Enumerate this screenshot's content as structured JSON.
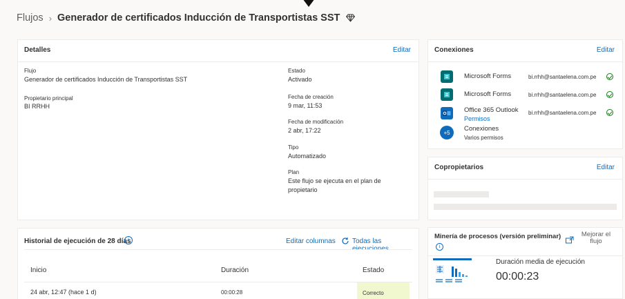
{
  "breadcrumb": {
    "root": "Flujos",
    "separator": "›",
    "title": "Generador de certificados Inducción de Transportistas SST",
    "premium_icon": "diamond-icon"
  },
  "details": {
    "title": "Detalles",
    "edit": "Editar",
    "flow_label": "Flujo",
    "flow_value": "Generador de certificados Inducción de Transportistas SST",
    "owner_label": "Propietario principal",
    "owner_value": "BI RRHH",
    "status_label": "Estado",
    "status_value": "Activado",
    "created_label": "Fecha de creación",
    "created_value": "9 mar, 11:53",
    "modified_label": "Fecha de modificación",
    "modified_value": "2 abr, 17:22",
    "type_label": "Tipo",
    "type_value": "Automatizado",
    "plan_label": "Plan",
    "plan_line1": "Este flujo se ejecuta en el plan de",
    "plan_line2": "propietario"
  },
  "connections": {
    "title": "Conexiones",
    "edit": "Editar",
    "items": [
      {
        "name": "Microsoft Forms",
        "email": "bi.rrhh@santaelena.com.pe",
        "icon": "forms-icon",
        "color": "#036c70"
      },
      {
        "name": "Microsoft Forms",
        "email": "bi.rrhh@santaelena.com.pe",
        "icon": "forms-icon",
        "color": "#036c70"
      },
      {
        "name": "Office 365 Outlook",
        "sub": "Permisos",
        "email": "bi.rrhh@santaelena.com.pe",
        "icon": "outlook-icon",
        "color": "#0f6cbd"
      },
      {
        "name": "Conexiones",
        "sub": "Varios permisos",
        "badge": "+5",
        "color": "#0f6cbd"
      }
    ]
  },
  "coowners": {
    "title": "Copropietarios",
    "edit": "Editar"
  },
  "history": {
    "title": "Historial de ejecución de 28 días",
    "edit_columns": "Editar columnas",
    "all_runs": "Todas las ejecuciones",
    "columns": [
      "Inicio",
      "Duración",
      "Estado"
    ],
    "rows": [
      {
        "start": "24 abr, 12:47 (hace 1 d)",
        "duration": "00:00:28",
        "status": "Correcto"
      }
    ]
  },
  "mining": {
    "title": "Minería de procesos (versión preliminar)",
    "improve_line1": "Mejorar el",
    "improve_line2": "flujo",
    "avg_label": "Duración media de ejecución",
    "avg_value": "00:00:23"
  },
  "colors": {
    "accent": "#0f6cbd",
    "success": "#107c10",
    "success_bg": "#f1f8cf"
  }
}
